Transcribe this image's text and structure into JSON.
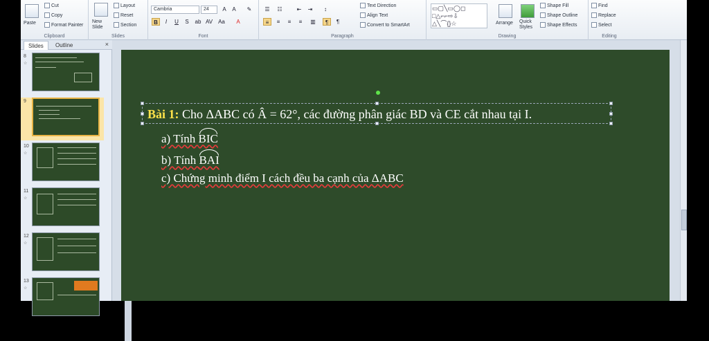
{
  "ribbon": {
    "clipboard": {
      "paste": "Paste",
      "cut": "Cut",
      "copy": "Copy",
      "format_painter": "Format Painter",
      "label": "Clipboard"
    },
    "slides": {
      "new_slide": "New Slide",
      "layout": "Layout",
      "reset": "Reset",
      "section": "Section",
      "label": "Slides"
    },
    "font": {
      "family": "Cambria",
      "size": "24",
      "bold": "B",
      "italic": "I",
      "underline": "U",
      "strike": "S",
      "label": "Font"
    },
    "paragraph": {
      "text_direction": "Text Direction",
      "align_text": "Align Text",
      "convert_smartart": "Convert to SmartArt",
      "label": "Paragraph"
    },
    "drawing": {
      "arrange": "Arrange",
      "quick_styles": "Quick Styles",
      "shape_fill": "Shape Fill",
      "shape_outline": "Shape Outline",
      "shape_effects": "Shape Effects",
      "label": "Drawing"
    },
    "editing": {
      "find": "Find",
      "replace": "Replace",
      "select": "Select",
      "label": "Editing"
    }
  },
  "panel": {
    "tab_slides": "Slides",
    "tab_outline": "Outline",
    "close": "×",
    "thumbs": [
      {
        "num": "8"
      },
      {
        "num": "9"
      },
      {
        "num": "10"
      },
      {
        "num": "11"
      },
      {
        "num": "12"
      },
      {
        "num": "13"
      }
    ]
  },
  "slide": {
    "title_prefix": "Bài 1:",
    "title_text": " Cho ΔABC có Â = 62°, các đường phân giác BD và CE cắt nhau tại I.",
    "a_prefix": "a) Tính ",
    "a_angle": "BIC",
    "b_prefix": "b) Tính ",
    "b_angle": "BAI",
    "c_text": "c) Chứng minh điểm I cách đều ba cạnh của ΔABC"
  }
}
